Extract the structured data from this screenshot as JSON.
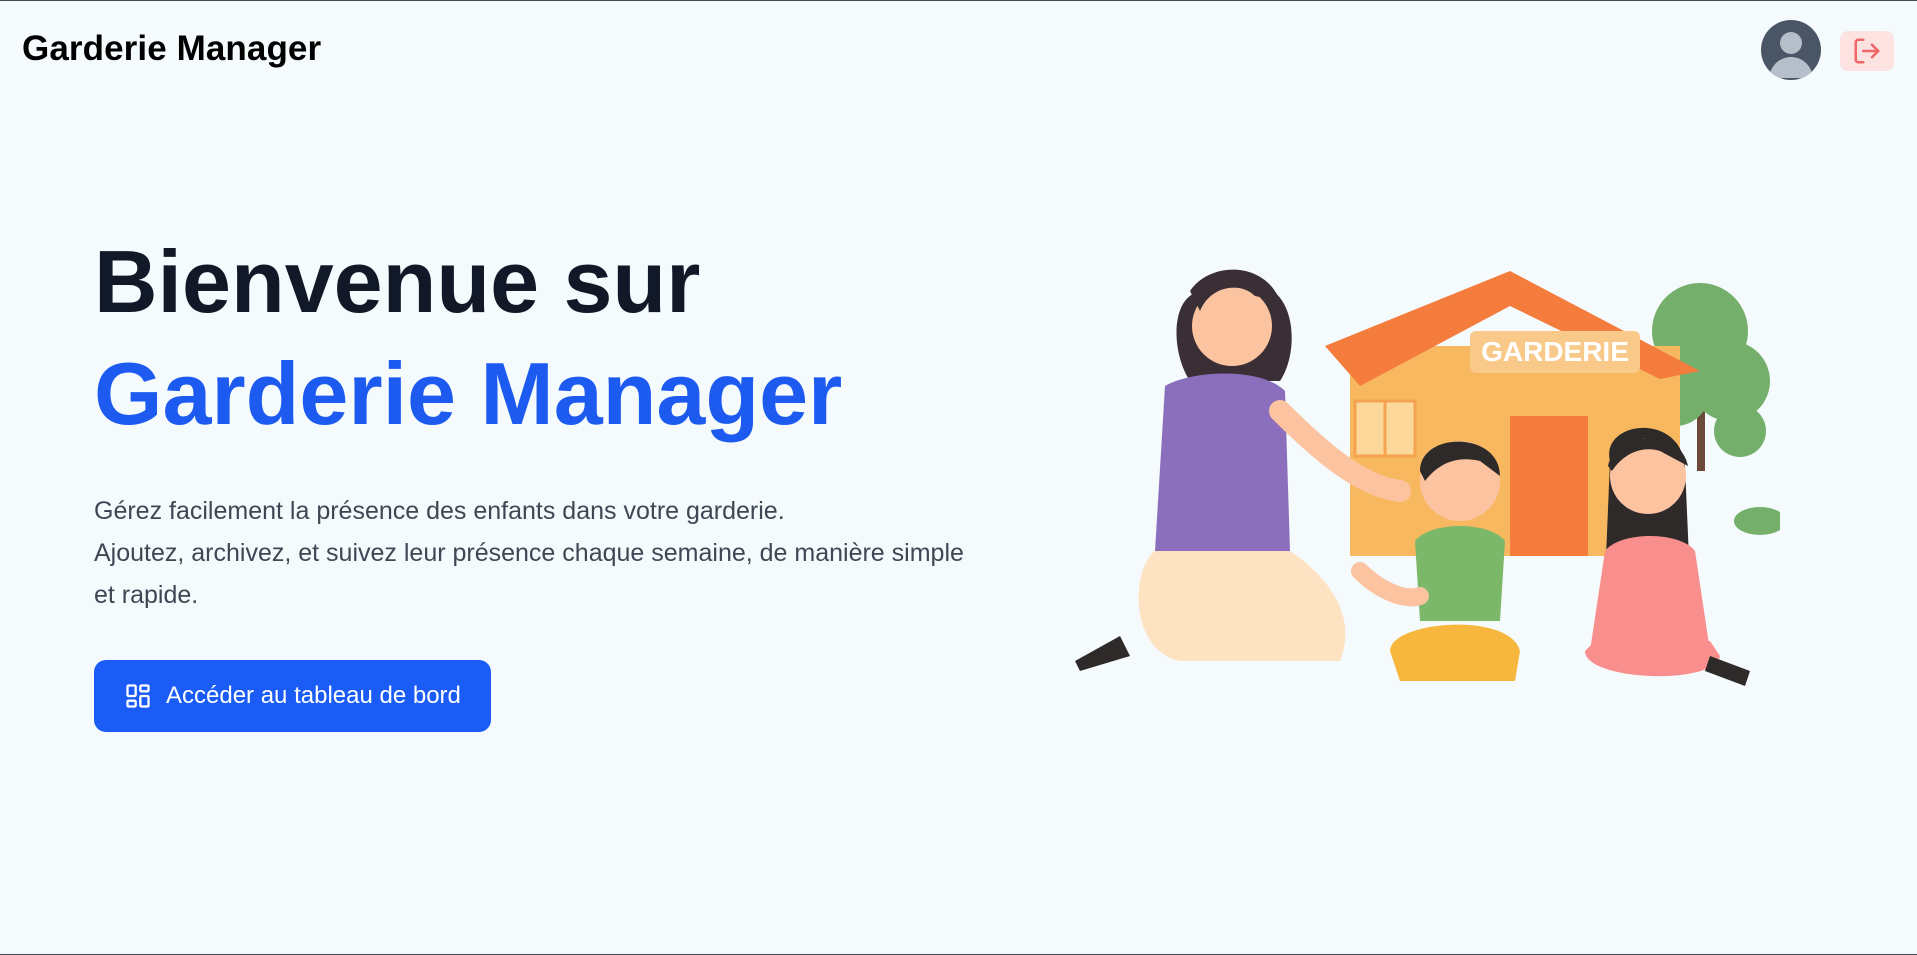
{
  "header": {
    "brand": "Garderie Manager",
    "avatar_icon": "user-avatar-icon",
    "logout_icon": "logout-icon"
  },
  "hero": {
    "title_line1": "Bienvenue sur",
    "title_line2": "Garderie Manager",
    "description_line1": "Gérez facilement la présence des enfants dans votre garderie.",
    "description_line2": "Ajoutez, archivez, et suivez leur présence chaque semaine, de manière simple et rapide.",
    "cta_label": "Accéder au tableau de bord",
    "cta_icon": "dashboard-grid-icon"
  },
  "illustration": {
    "sign_text": "GARDERIE"
  },
  "colors": {
    "accent": "#1a5cf5",
    "title": "#111827",
    "background": "#f5fafd",
    "logout_bg": "#fde2e2",
    "logout_icon": "#f06565"
  }
}
